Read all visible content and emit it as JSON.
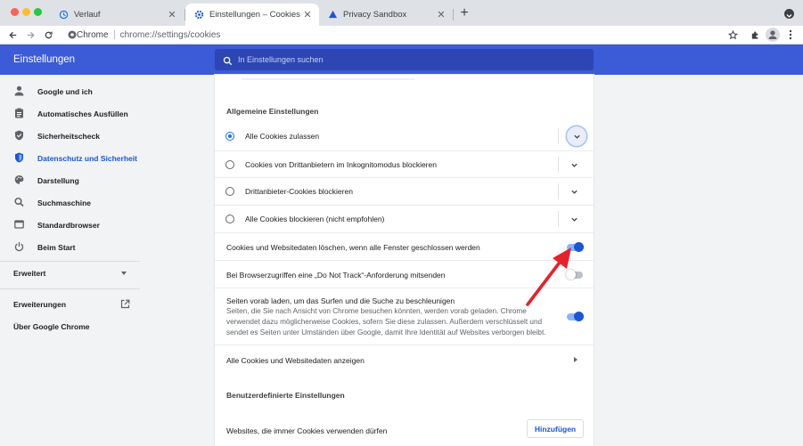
{
  "browser": {
    "tabs": [
      {
        "title": "Verlauf",
        "icon": "history-icon"
      },
      {
        "title": "Einstellungen – Cookies und and",
        "icon": "settings-gear-icon"
      },
      {
        "title": "Privacy Sandbox",
        "icon": "privacy-sandbox-icon"
      }
    ],
    "omnibox": {
      "chip": "Chrome",
      "url": "chrome://settings/cookies"
    }
  },
  "header": {
    "title": "Einstellungen",
    "search_placeholder": "In Einstellungen suchen"
  },
  "sidebar": {
    "items": [
      {
        "label": "Google und ich",
        "icon": "person-icon"
      },
      {
        "label": "Automatisches Ausfüllen",
        "icon": "clipboard-icon"
      },
      {
        "label": "Sicherheitscheck",
        "icon": "shield-icon"
      },
      {
        "label": "Datenschutz und Sicherheit",
        "icon": "shield-lock-icon",
        "active": true
      },
      {
        "label": "Darstellung",
        "icon": "palette-icon"
      },
      {
        "label": "Suchmaschine",
        "icon": "search-icon"
      },
      {
        "label": "Standardbrowser",
        "icon": "browser-icon"
      },
      {
        "label": "Beim Start",
        "icon": "power-icon"
      }
    ],
    "advanced": "Erweitert",
    "extensions": "Erweiterungen",
    "about": "Über Google Chrome"
  },
  "main": {
    "general_title": "Allgemeine Einstellungen",
    "options": [
      {
        "label": "Alle Cookies zulassen",
        "checked": true
      },
      {
        "label": "Cookies von Drittanbietern im Inkognitomodus blockieren",
        "checked": false
      },
      {
        "label": "Drittanbieter-Cookies blockieren",
        "checked": false
      },
      {
        "label": "Alle Cookies blockieren (nicht empfohlen)",
        "checked": false
      }
    ],
    "clear_on_exit": {
      "label": "Cookies und Websitedaten löschen, wenn alle Fenster geschlossen werden",
      "on": true
    },
    "do_not_track": {
      "label": "Bei Browserzugriffen eine „Do Not Track“-Anforderung mitsenden",
      "on": false
    },
    "preload": {
      "title": "Seiten vorab laden, um das Surfen und die Suche zu beschleunigen",
      "line1": "Seiten, die Sie nach Ansicht von Chrome besuchen könnten, werden vorab geladen. Chrome",
      "line2": "verwendet dazu möglicherweise Cookies, sofern Sie diese zulassen. Außerdem verschlüsselt und",
      "line3": "sendet es Seiten unter Umständen über Google, damit Ihre Identität auf Websites verborgen bleibt.",
      "on": true
    },
    "all_cookies": "Alle Cookies und Websitedaten anzeigen",
    "custom_title": "Benutzerdefinierte Einstellungen",
    "allow_label": "Websites, die immer Cookies verwenden dürfen",
    "add_button": "Hinzufügen"
  },
  "colors": {
    "accent": "#1a56d6",
    "header": "#3c5bd7",
    "annotation": "#e8202a"
  }
}
